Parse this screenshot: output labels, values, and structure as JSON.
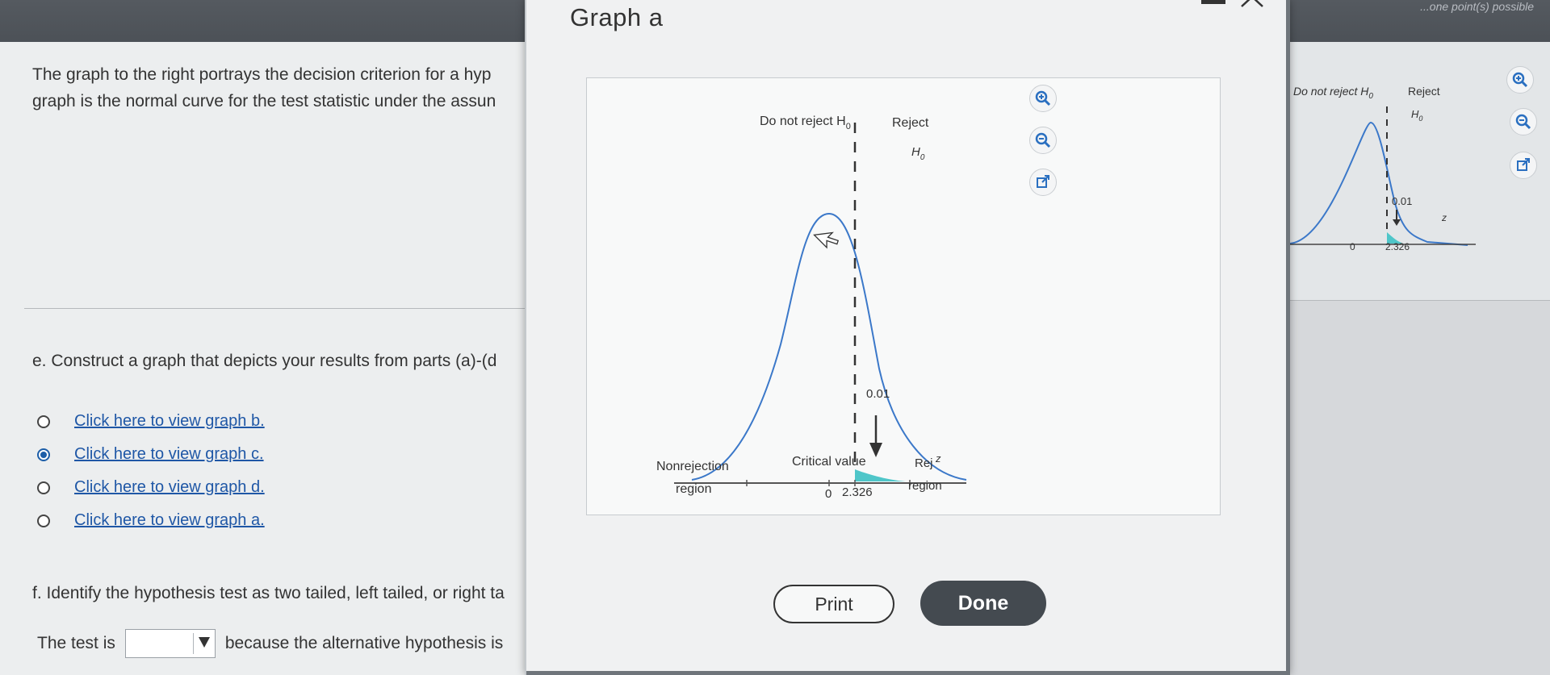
{
  "topbar": {
    "right_text": "...one point(s) possible"
  },
  "left_panel": {
    "intro_line1": "The graph to the right portrays the decision criterion for a hyp",
    "intro_line2": "graph is the normal curve for the test statistic under the assun",
    "part_e": "e. Construct a graph that depicts your results from parts (a)-(d",
    "options": [
      {
        "label": "Click here to view graph b.",
        "checked": false
      },
      {
        "label": "Click here to view graph c.",
        "checked": true
      },
      {
        "label": "Click here to view graph d.",
        "checked": false
      },
      {
        "label": "Click here to view graph a.",
        "checked": false
      }
    ],
    "part_f": "f. Identify the hypothesis test as two tailed, left tailed, or right ta",
    "test_prefix": "The test is",
    "test_value": "",
    "test_suffix": "because the alternative hypothesis is"
  },
  "thumbnail": {
    "do_not_reject": "Do not reject H",
    "reject": "Reject",
    "h0": "H",
    "sub0": "0",
    "alpha": "0.01",
    "z": "z",
    "tick0": "0",
    "tick_crit": "2.326"
  },
  "modal": {
    "title": "Graph a",
    "graph": {
      "do_not_reject": "Do not reject H",
      "sub0": "0",
      "reject": "Reject",
      "h0": "H",
      "alpha": "0.01",
      "nonrejection_line1": "Nonrejection",
      "nonrejection_line2": "region",
      "critical_value": "Critical value",
      "rej_line1": "Rej",
      "rej_line2": "region",
      "z": "z",
      "tick0": "0",
      "tick_crit": "2.326"
    },
    "print_label": "Print",
    "done_label": "Done"
  },
  "colors": {
    "curve": "#3b78c9",
    "reject_fill": "#4fc6c9",
    "link": "#1f57a6",
    "done_bg": "#444a50"
  },
  "icons": [
    "zoom-in-icon",
    "zoom-out-icon",
    "pop-out-icon",
    "mouse-cursor-icon"
  ]
}
